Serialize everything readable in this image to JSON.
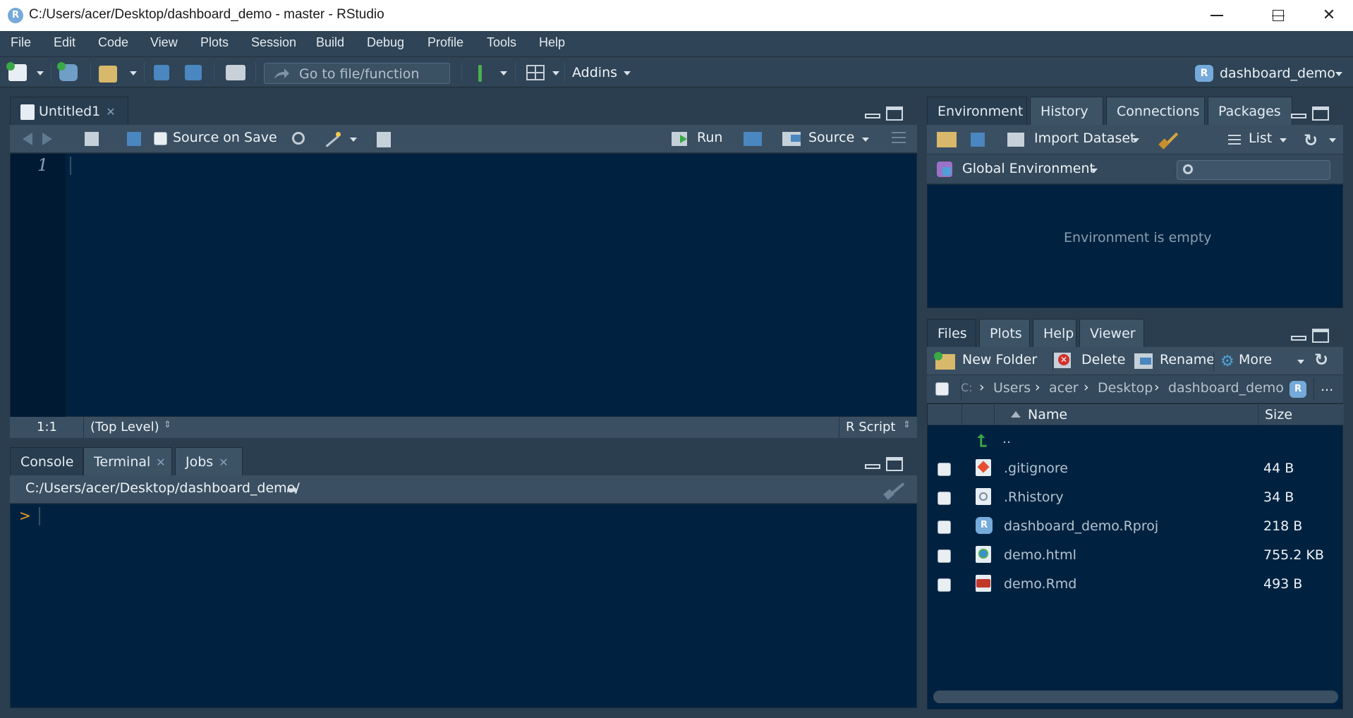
{
  "window": {
    "title": "C:/Users/acer/Desktop/dashboard_demo - master - RStudio",
    "logo_letter": "R",
    "minimize": "—",
    "maximize": "☐",
    "close": "✕"
  },
  "menu": [
    "File",
    "Edit",
    "Code",
    "View",
    "Plots",
    "Session",
    "Build",
    "Debug",
    "Profile",
    "Tools",
    "Help"
  ],
  "toolbar": {
    "goto_placeholder": "Go to file/function",
    "addins_label": "Addins",
    "project_label": "dashboard_demo"
  },
  "editor": {
    "tab_label": "Untitled1",
    "source_on_save": "Source on Save",
    "run_label": "Run",
    "source_label": "Source",
    "line_number": "1",
    "status_pos": "1:1",
    "status_scope": "(Top Level)",
    "status_type": "R Script"
  },
  "console": {
    "tabs": [
      "Console",
      "Terminal",
      "Jobs"
    ],
    "path": "C:/Users/acer/Desktop/dashboard_demo/",
    "prompt": ">"
  },
  "environment": {
    "tabs": [
      "Environment",
      "History",
      "Connections",
      "Packages"
    ],
    "import_label": "Import Dataset",
    "list_label": "List",
    "scope_label": "Global Environment",
    "empty_message": "Environment is empty"
  },
  "files": {
    "tabs": [
      "Files",
      "Plots",
      "Help",
      "Viewer"
    ],
    "new_folder": "New Folder",
    "delete": "Delete",
    "rename": "Rename",
    "more": "More",
    "breadcrumb": [
      "C:",
      "Users",
      "acer",
      "Desktop",
      "dashboard_demo"
    ],
    "ellipsis": "...",
    "col_name": "Name",
    "col_size": "Size",
    "up_label": "..",
    "items": [
      {
        "name": ".gitignore",
        "size": "44 B",
        "icon": "git-file-icon"
      },
      {
        "name": ".Rhistory",
        "size": "34 B",
        "icon": "history-file-icon"
      },
      {
        "name": "dashboard_demo.Rproj",
        "size": "218 B",
        "icon": "rproj-file-icon"
      },
      {
        "name": "demo.html",
        "size": "755.2 KB",
        "icon": "html-file-icon"
      },
      {
        "name": "demo.Rmd",
        "size": "493 B",
        "icon": "rmd-file-icon"
      }
    ]
  },
  "colors": {
    "chrome": "#2b3e50",
    "editor_bg": "#002240",
    "prompt": "#f0a020"
  }
}
